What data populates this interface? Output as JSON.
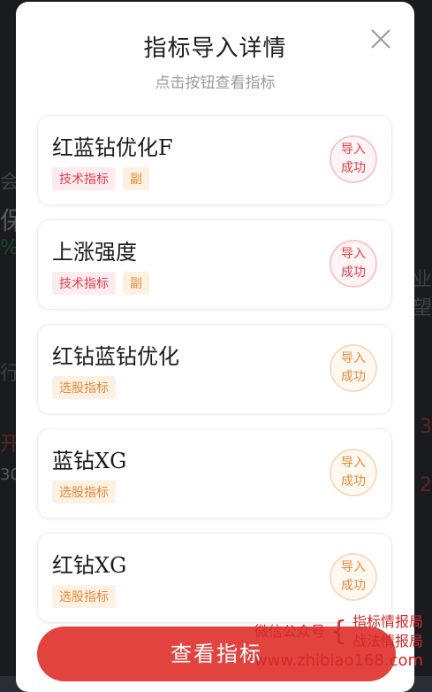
{
  "modal": {
    "title": "指标导入详情",
    "subtitle": "点击按钮查看指标",
    "close_icon": "close-icon"
  },
  "items": [
    {
      "name": "红蓝钻优化F",
      "tags": [
        "技术指标",
        "副"
      ],
      "status": "导入成功",
      "status_line1": "导入",
      "status_line2": "成功",
      "tone": "red"
    },
    {
      "name": "上涨强度",
      "tags": [
        "技术指标",
        "副"
      ],
      "status": "导入成功",
      "status_line1": "导入",
      "status_line2": "成功",
      "tone": "red"
    },
    {
      "name": "红钻蓝钻优化",
      "tags": [
        "选股指标"
      ],
      "status": "导入成功",
      "status_line1": "导入",
      "status_line2": "成功",
      "tone": "orange"
    },
    {
      "name": "蓝钻XG",
      "tags": [
        "选股指标"
      ],
      "status": "导入成功",
      "status_line1": "导入",
      "status_line2": "成功",
      "tone": "orange"
    },
    {
      "name": "红钻XG",
      "tags": [
        "选股指标"
      ],
      "status": "导入成功",
      "status_line1": "导入",
      "status_line2": "成功",
      "tone": "orange"
    }
  ],
  "button": {
    "label": "查看指标"
  },
  "watermark": {
    "left": "微信公众号",
    "line1": "指标情报局",
    "line2": "战法情报局",
    "url": "www.zhibiao168.com"
  },
  "background": {
    "left_chars": [
      "会",
      "保",
      "%",
      "行",
      "开",
      "30"
    ],
    "right_chars": [
      "业",
      "望",
      "3",
      "2"
    ]
  },
  "colors": {
    "accent": "#e2433f",
    "tag_red": "#e0404a",
    "tag_orange": "#e28a3a"
  }
}
